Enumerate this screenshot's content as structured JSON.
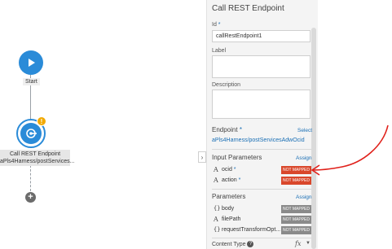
{
  "flow": {
    "start_label": "Start",
    "rest_node_label_line1": "Call REST Endpoint",
    "rest_node_label_line2": "aPls4Harness/postServices...",
    "warning_glyph": "!",
    "add_glyph": "+",
    "collapse_glyph": "›"
  },
  "panel": {
    "title": "Call REST Endpoint",
    "id_label": "Id",
    "id_value": "callRestEndpoint1",
    "label_label": "Label",
    "description_label": "Description",
    "endpoint_label": "Endpoint",
    "endpoint_select": "Select",
    "endpoint_value": "aPls4Harness/postServicesAdwOcid",
    "input_params_label": "Input Parameters",
    "input_params_assign": "Assign",
    "input_params": [
      {
        "type_glyph": "A",
        "name": "ocid",
        "required": true,
        "status": "NOT MAPPED"
      },
      {
        "type_glyph": "A",
        "name": "action",
        "required": true,
        "status": "NOT MAPPED"
      }
    ],
    "params_label": "Parameters",
    "params_assign": "Assign",
    "params": [
      {
        "type_glyph": "{}",
        "name": "body",
        "status": "NOT MAPPED"
      },
      {
        "type_glyph": "A",
        "name": "filePath",
        "status": "NOT MAPPED"
      },
      {
        "type_glyph": "{}",
        "name": "requestTransformOpt...",
        "status": "NOT MAPPED"
      }
    ],
    "content_type_label": "Content Type",
    "help_glyph": "?",
    "fx_glyph": "fx",
    "fx_caret": "▼",
    "required_mark": "*"
  },
  "colors": {
    "accent": "#2a8bd8",
    "link": "#1a6fb5",
    "status_not_mapped_input": "#d9472b",
    "status_not_mapped_param": "#8a8a8a",
    "annotation_arrow": "#e0201a",
    "warning": "#f2a900"
  },
  "icons": {
    "start": "play-icon",
    "rest": "rest-endpoint-icon",
    "warning": "warning-icon",
    "add": "plus-icon",
    "help": "help-icon"
  }
}
